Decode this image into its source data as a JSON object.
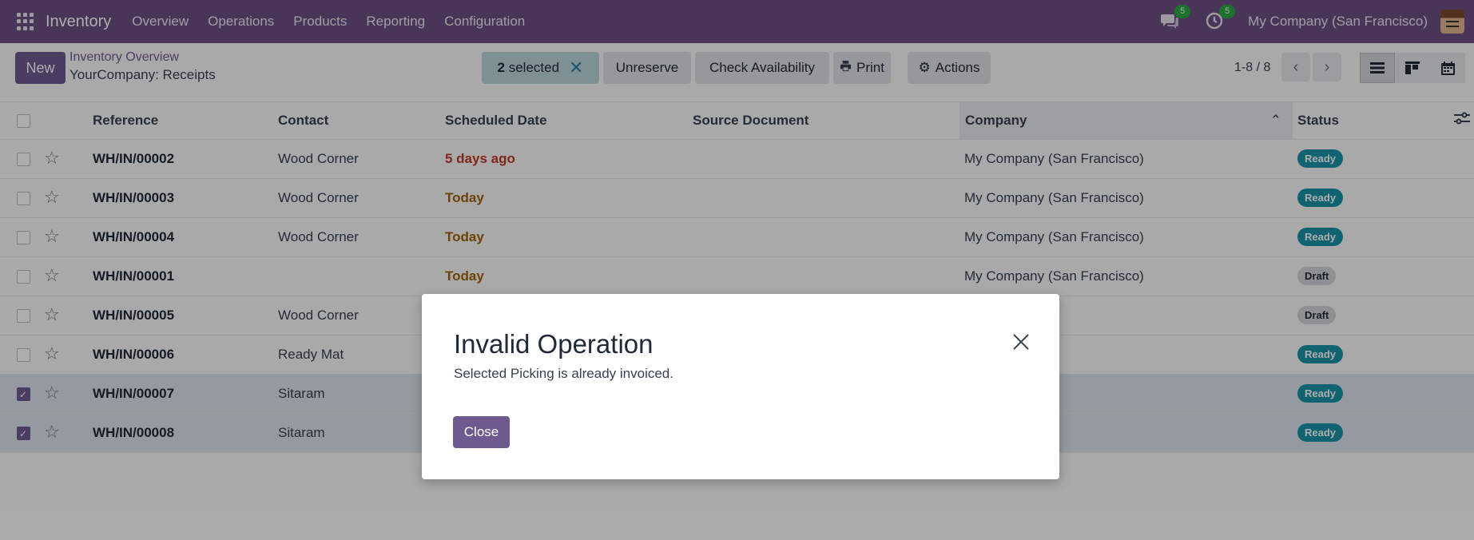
{
  "navbar": {
    "app_name": "Inventory",
    "menu": [
      "Overview",
      "Operations",
      "Products",
      "Reporting",
      "Configuration"
    ],
    "messages_count": "5",
    "activities_count": "5",
    "company": "My Company (San Francisco)"
  },
  "control": {
    "new_label": "New",
    "breadcrumb_parent": "Inventory Overview",
    "breadcrumb_current": "YourCompany: Receipts",
    "selected_count": "2",
    "selected_label": "selected",
    "unreserve_label": "Unreserve",
    "check_availability_label": "Check Availability",
    "print_label": "Print",
    "actions_label": "Actions",
    "pager": "1-8 / 8"
  },
  "table": {
    "headers": {
      "reference": "Reference",
      "contact": "Contact",
      "scheduled_date": "Scheduled Date",
      "source_document": "Source Document",
      "company": "Company",
      "status": "Status"
    },
    "rows": [
      {
        "reference": "WH/IN/00002",
        "contact": "Wood Corner",
        "date": "5 days ago",
        "date_style": "late",
        "company": "My Company (San Francisco)",
        "status": "Ready",
        "status_style": "ready",
        "checked": false
      },
      {
        "reference": "WH/IN/00003",
        "contact": "Wood Corner",
        "date": "Today",
        "date_style": "today",
        "company": "My Company (San Francisco)",
        "status": "Ready",
        "status_style": "ready",
        "checked": false
      },
      {
        "reference": "WH/IN/00004",
        "contact": "Wood Corner",
        "date": "Today",
        "date_style": "today",
        "company": "My Company (San Francisco)",
        "status": "Ready",
        "status_style": "ready",
        "checked": false
      },
      {
        "reference": "WH/IN/00001",
        "contact": "",
        "date": "Today",
        "date_style": "today",
        "company": "My Company (San Francisco)",
        "status": "Draft",
        "status_style": "draft",
        "checked": false
      },
      {
        "reference": "WH/IN/00005",
        "contact": "Wood Corner",
        "date": "",
        "date_style": "",
        "company": "an Francisco)",
        "status": "Draft",
        "status_style": "draft",
        "checked": false
      },
      {
        "reference": "WH/IN/00006",
        "contact": "Ready Mat",
        "date": "",
        "date_style": "",
        "company": "an Francisco)",
        "status": "Ready",
        "status_style": "ready",
        "checked": false
      },
      {
        "reference": "WH/IN/00007",
        "contact": "Sitaram",
        "date": "",
        "date_style": "",
        "company": "an Francisco)",
        "status": "Ready",
        "status_style": "ready",
        "checked": true
      },
      {
        "reference": "WH/IN/00008",
        "contact": "Sitaram",
        "date": "",
        "date_style": "",
        "company": "an Francisco)",
        "status": "Ready",
        "status_style": "ready",
        "checked": true
      }
    ]
  },
  "dialog": {
    "title": "Invalid Operation",
    "message": "Selected Picking is already invoiced.",
    "close_label": "Close"
  },
  "colors": {
    "navbar": "#6b4f82",
    "primary": "#6f5a8f",
    "ready_badge": "#1a93a8",
    "late_date": "#c0392b",
    "today_date": "#a16207"
  }
}
